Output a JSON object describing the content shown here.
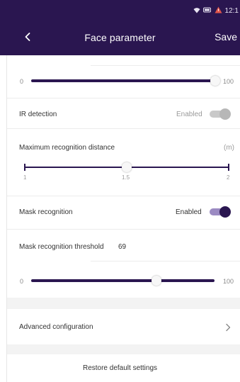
{
  "status_bar": {
    "time": "12:1",
    "icons": [
      "wifi-icon",
      "battery-icon",
      "alert-icon"
    ]
  },
  "app_bar": {
    "title": "Face parameter",
    "save_label": "Save",
    "back_icon": "chevron-left-icon"
  },
  "top_slider": {
    "min_label": "0",
    "max_label": "100",
    "value_fraction": 1.0
  },
  "ir_detection": {
    "label": "IR detection",
    "status": "Enabled",
    "toggle_on": false
  },
  "max_distance": {
    "label": "Maximum recognition distance",
    "unit": "(m)",
    "min_label": "1",
    "mid_label": "1.5",
    "max_label": "2",
    "value": 1.5
  },
  "mask_recognition": {
    "label": "Mask recognition",
    "status": "Enabled",
    "toggle_on": true
  },
  "mask_threshold": {
    "label": "Mask recognition threshold",
    "value": "69",
    "min_label": "0",
    "max_label": "100",
    "value_fraction": 0.69
  },
  "advanced": {
    "label": "Advanced configuration",
    "icon": "chevron-right-icon"
  },
  "restore": {
    "label": "Restore default settings"
  },
  "colors": {
    "primary": "#2a1650",
    "toggle_on_track": "#9b8ac2",
    "toggle_off": "#c9c9c9",
    "section_bg": "#f3f3f3"
  }
}
